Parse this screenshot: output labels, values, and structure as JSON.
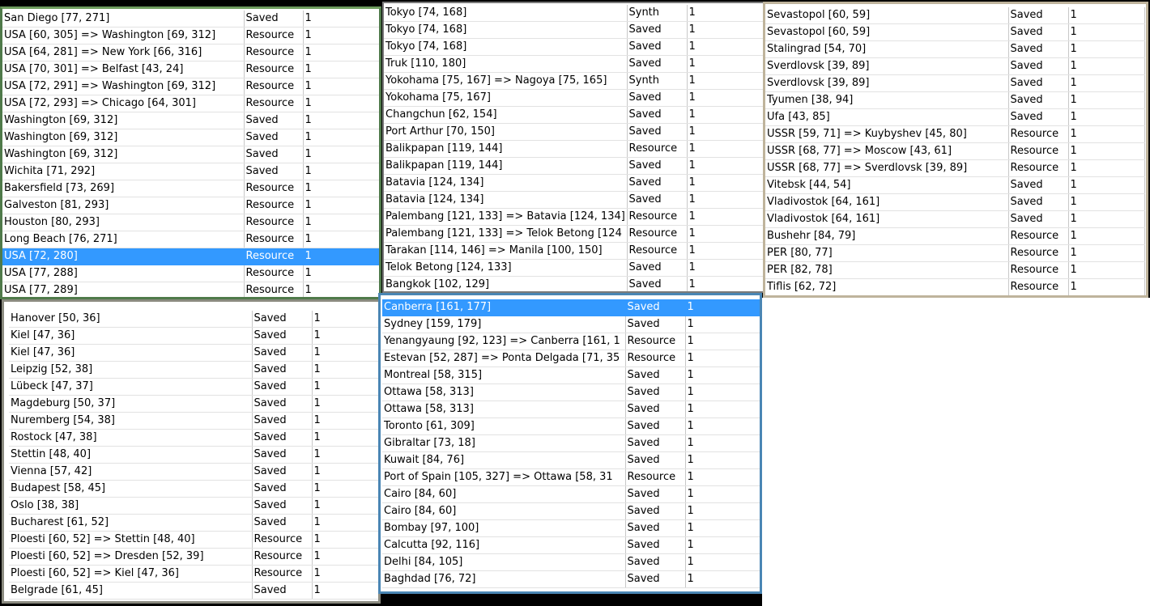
{
  "panels": [
    {
      "rows": [
        [
          "San Diego [77, 271]",
          "Saved",
          "1"
        ],
        [
          "USA [60, 305] => Washington [69, 312]",
          "Resource",
          "1"
        ],
        [
          "USA [64, 281] => New York [66, 316]",
          "Resource",
          "1"
        ],
        [
          "USA [70, 301] => Belfast [43, 24]",
          "Resource",
          "1"
        ],
        [
          "USA [72, 291] => Washington [69, 312]",
          "Resource",
          "1"
        ],
        [
          "USA [72, 293] => Chicago [64, 301]",
          "Resource",
          "1"
        ],
        [
          "Washington [69, 312]",
          "Saved",
          "1"
        ],
        [
          "Washington [69, 312]",
          "Saved",
          "1"
        ],
        [
          "Washington [69, 312]",
          "Saved",
          "1"
        ],
        [
          "Wichita [71, 292]",
          "Saved",
          "1"
        ],
        [
          "Bakersfield [73, 269]",
          "Resource",
          "1"
        ],
        [
          "Galveston [81, 293]",
          "Resource",
          "1"
        ],
        [
          "Houston [80, 293]",
          "Resource",
          "1"
        ],
        [
          "Long Beach [76, 271]",
          "Resource",
          "1"
        ],
        [
          "USA [72, 280]",
          "Resource",
          "1"
        ],
        [
          "USA [77, 288]",
          "Resource",
          "1"
        ],
        [
          "USA [77, 289]",
          "Resource",
          "1"
        ]
      ],
      "selected_index": 14
    },
    {
      "rows": [
        [
          "Tokyo [74, 168]",
          "Synth",
          "1"
        ],
        [
          "Tokyo [74, 168]",
          "Saved",
          "1"
        ],
        [
          "Tokyo [74, 168]",
          "Saved",
          "1"
        ],
        [
          "Truk [110, 180]",
          "Saved",
          "1"
        ],
        [
          "Yokohama [75, 167] => Nagoya [75, 165]",
          "Synth",
          "1"
        ],
        [
          "Yokohama [75, 167]",
          "Saved",
          "1"
        ],
        [
          "Changchun [62, 154]",
          "Saved",
          "1"
        ],
        [
          "Port Arthur [70, 150]",
          "Saved",
          "1"
        ],
        [
          "Balikpapan [119, 144]",
          "Resource",
          "1"
        ],
        [
          "Balikpapan [119, 144]",
          "Saved",
          "1"
        ],
        [
          "Batavia [124, 134]",
          "Saved",
          "1"
        ],
        [
          "Batavia [124, 134]",
          "Saved",
          "1"
        ],
        [
          "Palembang [121, 133] => Batavia [124, 134]",
          "Resource",
          "1"
        ],
        [
          "Palembang [121, 133] => Telok Betong [124",
          "Resource",
          "1"
        ],
        [
          "Tarakan [114, 146] => Manila [100, 150]",
          "Resource",
          "1"
        ],
        [
          "Telok Betong [124, 133]",
          "Saved",
          "1"
        ],
        [
          "Bangkok [102, 129]",
          "Saved",
          "1"
        ]
      ],
      "selected_index": -1
    },
    {
      "rows": [
        [
          "Sevastopol [60, 59]",
          "Saved",
          "1"
        ],
        [
          "Sevastopol [60, 59]",
          "Saved",
          "1"
        ],
        [
          "Stalingrad [54, 70]",
          "Saved",
          "1"
        ],
        [
          "Sverdlovsk [39, 89]",
          "Saved",
          "1"
        ],
        [
          "Sverdlovsk [39, 89]",
          "Saved",
          "1"
        ],
        [
          "Tyumen [38, 94]",
          "Saved",
          "1"
        ],
        [
          "Ufa [43, 85]",
          "Saved",
          "1"
        ],
        [
          "USSR [59, 71] => Kuybyshev [45, 80]",
          "Resource",
          "1"
        ],
        [
          "USSR [68, 77] => Moscow [43, 61]",
          "Resource",
          "1"
        ],
        [
          "USSR [68, 77] => Sverdlovsk [39, 89]",
          "Resource",
          "1"
        ],
        [
          "Vitebsk [44, 54]",
          "Saved",
          "1"
        ],
        [
          "Vladivostok [64, 161]",
          "Saved",
          "1"
        ],
        [
          "Vladivostok [64, 161]",
          "Saved",
          "1"
        ],
        [
          "Bushehr [84, 79]",
          "Resource",
          "1"
        ],
        [
          "PER [80, 77]",
          "Resource",
          "1"
        ],
        [
          "PER [82, 78]",
          "Resource",
          "1"
        ],
        [
          "Tiflis [62, 72]",
          "Resource",
          "1"
        ]
      ],
      "selected_index": -1
    },
    {
      "rows": [
        [
          "Hanover [50, 36]",
          "Saved",
          "1"
        ],
        [
          "Kiel [47, 36]",
          "Saved",
          "1"
        ],
        [
          "Kiel [47, 36]",
          "Saved",
          "1"
        ],
        [
          "Leipzig [52, 38]",
          "Saved",
          "1"
        ],
        [
          "Lübeck [47, 37]",
          "Saved",
          "1"
        ],
        [
          "Magdeburg [50, 37]",
          "Saved",
          "1"
        ],
        [
          "Nuremberg [54, 38]",
          "Saved",
          "1"
        ],
        [
          "Rostock [47, 38]",
          "Saved",
          "1"
        ],
        [
          "Stettin [48, 40]",
          "Saved",
          "1"
        ],
        [
          "Vienna [57, 42]",
          "Saved",
          "1"
        ],
        [
          "Budapest [58, 45]",
          "Saved",
          "1"
        ],
        [
          "Oslo [38, 38]",
          "Saved",
          "1"
        ],
        [
          "Bucharest [61, 52]",
          "Saved",
          "1"
        ],
        [
          "Ploesti [60, 52] => Stettin [48, 40]",
          "Resource",
          "1"
        ],
        [
          "Ploesti [60, 52] => Dresden [52, 39]",
          "Resource",
          "1"
        ],
        [
          "Ploesti [60, 52] => Kiel [47, 36]",
          "Resource",
          "1"
        ],
        [
          "Belgrade [61, 45]",
          "Saved",
          "1"
        ]
      ],
      "selected_index": -1
    },
    {
      "rows": [
        [
          "Canberra [161, 177]",
          "Saved",
          "1"
        ],
        [
          "Sydney [159, 179]",
          "Saved",
          "1"
        ],
        [
          "Yenangyaung [92, 123] => Canberra [161, 1",
          "Resource",
          "1"
        ],
        [
          "Estevan [52, 287] => Ponta Delgada [71, 35",
          "Resource",
          "1"
        ],
        [
          "Montreal [58, 315]",
          "Saved",
          "1"
        ],
        [
          "Ottawa [58, 313]",
          "Saved",
          "1"
        ],
        [
          "Ottawa [58, 313]",
          "Saved",
          "1"
        ],
        [
          "Toronto [61, 309]",
          "Saved",
          "1"
        ],
        [
          "Gibraltar [73, 18]",
          "Saved",
          "1"
        ],
        [
          "Kuwait [84, 76]",
          "Saved",
          "1"
        ],
        [
          "Port of Spain [105, 327] => Ottawa [58, 31",
          "Resource",
          "1"
        ],
        [
          "Cairo [84, 60]",
          "Saved",
          "1"
        ],
        [
          "Cairo [84, 60]",
          "Saved",
          "1"
        ],
        [
          "Bombay [97, 100]",
          "Saved",
          "1"
        ],
        [
          "Calcutta [92, 116]",
          "Saved",
          "1"
        ],
        [
          "Delhi [84, 105]",
          "Saved",
          "1"
        ],
        [
          "Baghdad [76, 72]",
          "Saved",
          "1"
        ]
      ],
      "selected_index": 0
    }
  ],
  "colors": {
    "selection": "#3399ff",
    "background": "#000000",
    "row_bg": "#ffffff"
  }
}
